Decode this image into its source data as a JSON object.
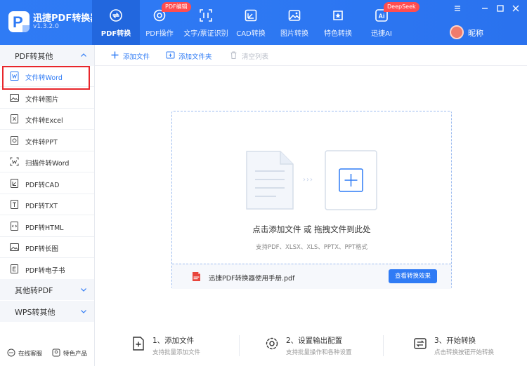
{
  "app": {
    "name": "迅捷PDF转换器",
    "version": "v1.3.2.0"
  },
  "nav": {
    "tabs": [
      {
        "label": "PDF转换",
        "icon": "convert-icon"
      },
      {
        "label": "PDF操作",
        "icon": "gear-icon",
        "badge": "PDF编辑"
      },
      {
        "label": "文字/票证识别",
        "icon": "scan-icon"
      },
      {
        "label": "CAD转换",
        "icon": "cad-icon"
      },
      {
        "label": "图片转换",
        "icon": "image-icon"
      },
      {
        "label": "特色转换",
        "icon": "star-icon"
      },
      {
        "label": "迅捷AI",
        "icon": "ai-icon",
        "icon_text": "Ai",
        "badge": "DeepSeek"
      }
    ],
    "active_index": 0
  },
  "user": {
    "nickname": "昵称"
  },
  "sidebar": {
    "categories": [
      {
        "label": "PDF转其他",
        "expanded": true
      },
      {
        "label": "其他转PDF",
        "expanded": false
      },
      {
        "label": "WPS转其他",
        "expanded": false
      }
    ],
    "items": [
      {
        "label": "文件转Word",
        "icon": "word-icon"
      },
      {
        "label": "文件转图片",
        "icon": "image-icon"
      },
      {
        "label": "文件转Excel",
        "icon": "excel-icon"
      },
      {
        "label": "文件转PPT",
        "icon": "ppt-icon"
      },
      {
        "label": "扫描件转Word",
        "icon": "scan-word-icon"
      },
      {
        "label": "PDF转CAD",
        "icon": "cad-icon"
      },
      {
        "label": "PDF转TXT",
        "icon": "txt-icon"
      },
      {
        "label": "PDF转HTML",
        "icon": "html-icon"
      },
      {
        "label": "PDF转长图",
        "icon": "long-image-icon"
      },
      {
        "label": "PDF转电子书",
        "icon": "ebook-icon"
      }
    ],
    "selected_index": 0,
    "bottom": [
      {
        "label": "在线客服",
        "icon": "chat-icon"
      },
      {
        "label": "特色产品",
        "icon": "product-icon"
      }
    ]
  },
  "toolbar": {
    "add_file": "添加文件",
    "add_folder": "添加文件夹",
    "clear_list": "清空列表"
  },
  "dropzone": {
    "title": "点击添加文件 或 拖拽文件到此处",
    "subtitle": "支持PDF、XLSX、XLS、PPTX、PPT格式",
    "arrows": "›››",
    "file_name": "迅捷PDF转换器使用手册.pdf",
    "view_button": "查看转换效果"
  },
  "steps": [
    {
      "title": "1、添加文件",
      "desc": "支持批量添加文件",
      "icon": "add-file-icon"
    },
    {
      "title": "2、设置输出配置",
      "desc": "支持批量操作和各种设置",
      "icon": "settings-icon"
    },
    {
      "title": "3、开始转换",
      "desc": "点击转换按钮开始转换",
      "icon": "convert-start-icon"
    }
  ],
  "colors": {
    "accent": "#2f7bf5",
    "badge": "#ff4d4f",
    "highlight": "#e8262b"
  }
}
